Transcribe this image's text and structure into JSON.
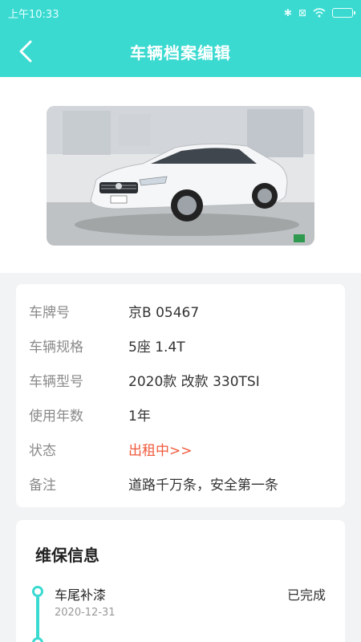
{
  "status_bar": {
    "time": "上午10:33"
  },
  "header": {
    "title": "车辆档案编辑"
  },
  "vehicle_info": {
    "rows": [
      {
        "label": "车牌号",
        "value": "京B 05467"
      },
      {
        "label": "车辆规格",
        "value": "5座 1.4T"
      },
      {
        "label": "车辆型号",
        "value": "2020款 改款 330TSI"
      },
      {
        "label": "使用年数",
        "value": "1年"
      },
      {
        "label": "状态",
        "value": "出租中>>"
      },
      {
        "label": "备注",
        "value": "道路千万条，安全第一条"
      }
    ]
  },
  "maintenance": {
    "title": "维保信息",
    "items": [
      {
        "title": "车尾补漆",
        "date": "2020-12-31",
        "status": "已完成"
      },
      {
        "title": "",
        "date": "",
        "status": ""
      }
    ]
  },
  "colors": {
    "accent": "#3bdad1",
    "status_text": "#f05a3c"
  }
}
